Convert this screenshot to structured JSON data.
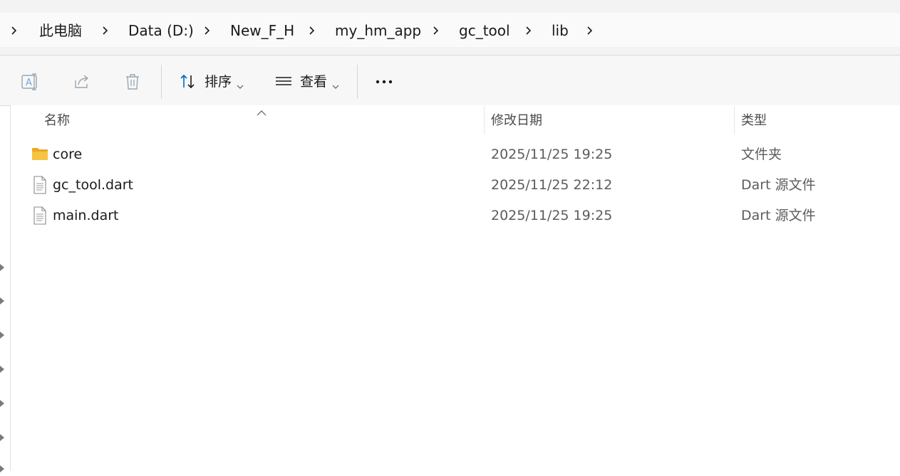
{
  "breadcrumb": {
    "items": [
      "此电脑",
      "Data (D:)",
      "New_F_H",
      "my_hm_app",
      "gc_tool",
      "lib"
    ]
  },
  "toolbar": {
    "rename_icon": "rename-icon",
    "share_icon": "share-icon",
    "delete_icon": "delete-icon",
    "sort_label": "排序",
    "view_label": "查看",
    "more_icon": "more-icon"
  },
  "columns": {
    "name": "名称",
    "modified": "修改日期",
    "type": "类型"
  },
  "files": [
    {
      "name": "core",
      "modified": "2025/11/25 19:25",
      "type": "文件夹",
      "icon": "folder-icon"
    },
    {
      "name": "gc_tool.dart",
      "modified": "2025/11/25 22:12",
      "type": "Dart 源文件",
      "icon": "file-icon"
    },
    {
      "name": "main.dart",
      "modified": "2025/11/25 19:25",
      "type": "Dart 源文件",
      "icon": "file-icon"
    }
  ],
  "colors": {
    "folder": "#f6c343",
    "accent": "#0067c0",
    "icon_disabled": "#9aa5b0"
  }
}
